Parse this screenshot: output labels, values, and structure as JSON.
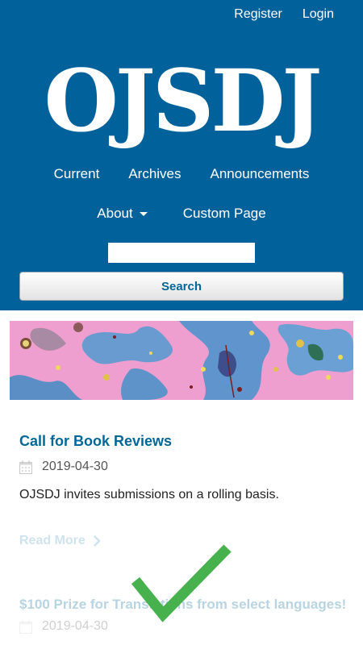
{
  "header": {
    "register_label": "Register",
    "login_label": "Login",
    "logo_text": "OJSDJ",
    "bg_color": "#01619b"
  },
  "nav": {
    "current": "Current",
    "archives": "Archives",
    "announcements": "Announcements",
    "about": "About",
    "custom_page": "Custom Page"
  },
  "search": {
    "value": "",
    "button_label": "Search"
  },
  "articles": [
    {
      "title": "Call for Book Reviews",
      "date": "2019-04-30",
      "summary": "OJSDJ invites submissions on a rolling basis.",
      "read_more": "Read More"
    },
    {
      "title": "$100 Prize for Translations from select languages!",
      "date": "2019-04-30"
    }
  ],
  "colors": {
    "link": "#006798",
    "checkmark": "#46b14d"
  },
  "icons": [
    "calendar-icon",
    "chevron-right-icon",
    "checkmark-icon",
    "caret-down-icon"
  ]
}
